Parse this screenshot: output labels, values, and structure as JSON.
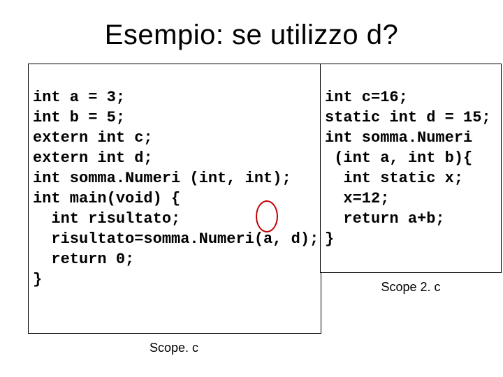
{
  "title": "Esempio: se utilizzo d?",
  "code_left": "int a = 3;\nint b = 5;\nextern int c;\nextern int d;\nint somma.Numeri (int, int);\nint main(void) {\n  int risultato;\n  risultato=somma.Numeri(a, d);\n  return 0;\n}",
  "code_right": "int c=16;\nstatic int d = 15;\nint somma.Numeri\n (int a, int b){\n  int static x;\n  x=12;\n  return a+b;\n}",
  "caption_left": "Scope. c",
  "caption_right": "Scope 2. c",
  "highlight": {
    "target": "d",
    "context": "risultato=somma.Numeri(a, d);"
  }
}
